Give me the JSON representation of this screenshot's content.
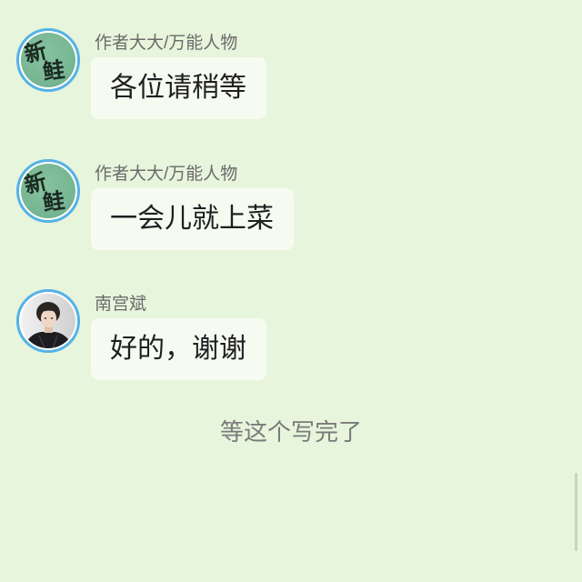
{
  "messages": [
    {
      "sender": "作者大大/万能人物",
      "text": "各位请稍等",
      "avatar": {
        "type": "calligraphy-logo",
        "glyphs": [
          "新",
          "鲑"
        ]
      }
    },
    {
      "sender": "作者大大/万能人物",
      "text": "一会儿就上菜",
      "avatar": {
        "type": "calligraphy-logo",
        "glyphs": [
          "新",
          "鲑"
        ]
      }
    },
    {
      "sender": "南宫斌",
      "text": "好的，谢谢",
      "avatar": {
        "type": "portrait-photo"
      }
    }
  ],
  "system_notice": "等这个写完了",
  "colors": {
    "background": "#e6f5dc",
    "bubble": "#f6fbf2",
    "avatar_ring": "#55b2e6",
    "logo_green": "#78b794",
    "sender_name": "#6b6b6b",
    "message_text": "#1f1f1f",
    "notice_text": "#7a7a7a"
  }
}
